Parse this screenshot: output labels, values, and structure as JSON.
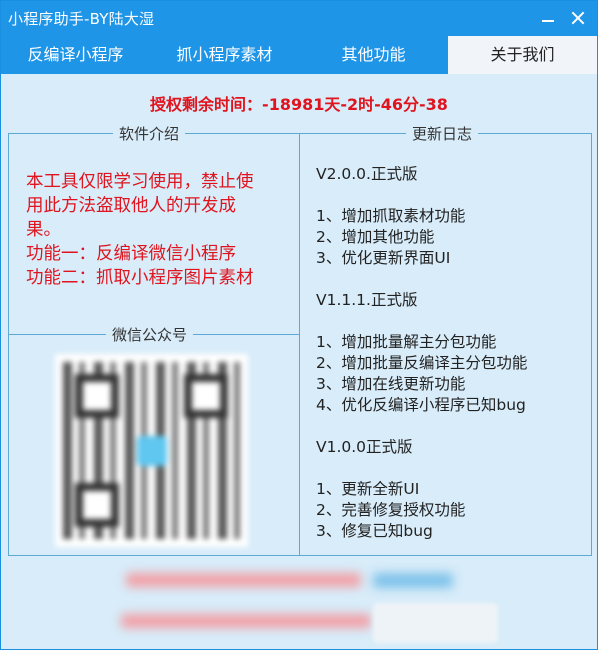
{
  "window": {
    "title": "小程序助手-BY陆大湿"
  },
  "tabs": [
    {
      "label": "反编译小程序",
      "active": false
    },
    {
      "label": "抓小程序素材",
      "active": false
    },
    {
      "label": "其他功能",
      "active": false
    },
    {
      "label": "关于我们",
      "active": true
    }
  ],
  "remaining": {
    "text": "授权剩余时间：-18981天-2时-46分-38"
  },
  "intro": {
    "title": "软件介绍",
    "lines": [
      "本工具仅限学习使用，禁止使",
      "用此方法盗取他人的开发成",
      "果。",
      "功能一：反编译微信小程序",
      "功能二：抓取小程序图片素材"
    ]
  },
  "wechat": {
    "title": "微信公众号"
  },
  "changelog": {
    "title": "更新日志",
    "versions": [
      {
        "version": "V2.0.0.正式版",
        "items": [
          "1、增加抓取素材功能",
          "2、增加其他功能",
          "3、优化更新界面UI"
        ]
      },
      {
        "version": "V1.1.1.正式版",
        "items": [
          "1、增加批量解主分包功能",
          "2、增加批量反编译主分包功能",
          "3、增加在线更新功能",
          "4、优化反编译小程序已知bug"
        ]
      },
      {
        "version": "V1.0.0正式版",
        "items": [
          "1、更新全新UI",
          "2、完善修复授权功能",
          "3、修复已知bug"
        ]
      }
    ]
  },
  "colors": {
    "titlebar": "#1f95e8",
    "accent_red": "#e0141e",
    "background": "#d8ecf9",
    "panel_border": "#5fa9d8"
  },
  "icons": {
    "minimize": "minimize-icon",
    "close": "close-icon"
  }
}
